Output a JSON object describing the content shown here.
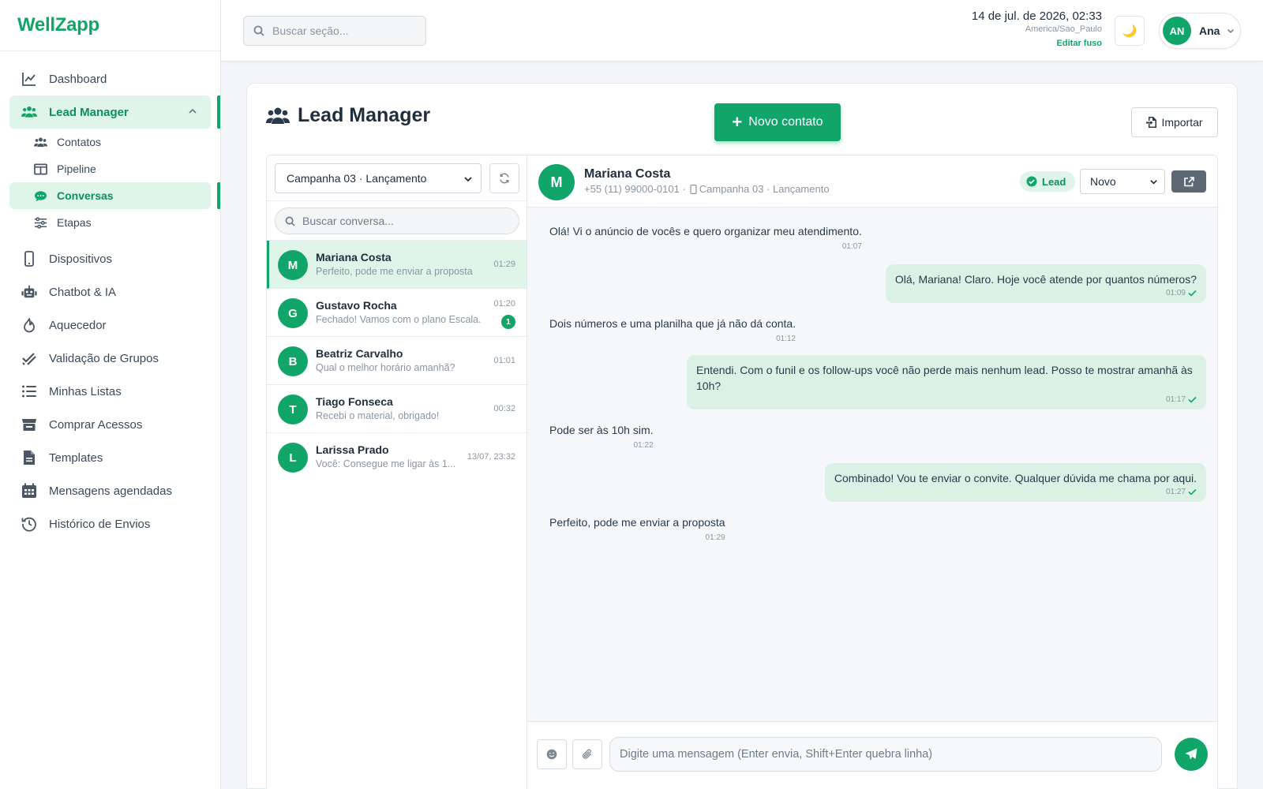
{
  "brand": {
    "name": "WellZapp"
  },
  "topbar": {
    "search_placeholder": "Buscar seção...",
    "datetime": "14 de jul. de 2026, 02:33",
    "timezone": "America/Sao_Paulo",
    "edit_timezone": "Editar fuso",
    "theme_icon": "moon-icon",
    "user": {
      "initials": "AN",
      "name": "Ana"
    }
  },
  "sidebar": {
    "items": [
      {
        "label": "Dashboard",
        "icon": "chart-line-icon"
      },
      {
        "label": "Lead Manager",
        "icon": "users-icon",
        "active": true,
        "expanded": true
      },
      {
        "label": "Dispositivos",
        "icon": "mobile-icon"
      },
      {
        "label": "Chatbot & IA",
        "icon": "robot-icon"
      },
      {
        "label": "Aquecedor",
        "icon": "fire-icon"
      },
      {
        "label": "Validação de Grupos",
        "icon": "check-double-icon"
      },
      {
        "label": "Minhas Listas",
        "icon": "list-icon"
      },
      {
        "label": "Comprar Acessos",
        "icon": "store-icon"
      },
      {
        "label": "Templates",
        "icon": "file-icon"
      },
      {
        "label": "Mensagens agendadas",
        "icon": "calendar-icon"
      },
      {
        "label": "Histórico de Envios",
        "icon": "history-icon"
      }
    ],
    "subitems": [
      {
        "label": "Contatos",
        "icon": "users-icon"
      },
      {
        "label": "Pipeline",
        "icon": "columns-icon"
      },
      {
        "label": "Conversas",
        "icon": "comments-icon",
        "active": true
      },
      {
        "label": "Etapas",
        "icon": "sliders-icon"
      }
    ]
  },
  "page": {
    "title": "Lead Manager",
    "new_contact": "Novo contato",
    "import": "Importar"
  },
  "conversations": {
    "campaign": "Campanha 03 · Lançamento",
    "search_placeholder": "Buscar conversa...",
    "items": [
      {
        "initial": "M",
        "name": "Mariana Costa",
        "preview": "Perfeito, pode me enviar a proposta",
        "time": "01:29",
        "active": true
      },
      {
        "initial": "G",
        "name": "Gustavo Rocha",
        "preview": "Fechado! Vamos com o plano Escala.",
        "time": "01:20",
        "unread": "1"
      },
      {
        "initial": "B",
        "name": "Beatriz Carvalho",
        "preview": "Qual o melhor horário amanhã?",
        "time": "01:01"
      },
      {
        "initial": "T",
        "name": "Tiago Fonseca",
        "preview": "Recebi o material, obrigado!",
        "time": "00:32"
      },
      {
        "initial": "L",
        "name": "Larissa Prado",
        "preview": "Você: Consegue me ligar às 1...",
        "time": "13/07, 23:32"
      }
    ]
  },
  "chat": {
    "contact": {
      "initial": "M",
      "name": "Mariana Costa",
      "phone": "+55 (11) 99000-0101 ·",
      "campaign": "Campanha 03 · Lançamento"
    },
    "tag": "Lead",
    "stage": "Novo",
    "messages": [
      {
        "dir": "in",
        "text": "Olá! Vi o anúncio de vocês e quero organizar meu atendimento.",
        "time": "01:07"
      },
      {
        "dir": "out",
        "text": "Olá, Mariana! Claro. Hoje você atende por quantos números?",
        "time": "01:09"
      },
      {
        "dir": "in",
        "text": "Dois números e uma planilha que já não dá conta.",
        "time": "01:12"
      },
      {
        "dir": "out",
        "text": "Entendi. Com o funil e os follow-ups você não perde mais nenhum lead. Posso te mostrar amanhã às 10h?",
        "time": "01:17"
      },
      {
        "dir": "in",
        "text": "Pode ser às 10h sim.",
        "time": "01:22"
      },
      {
        "dir": "out",
        "text": "Combinado! Vou te enviar o convite. Qualquer dúvida me chama por aqui.",
        "time": "01:27"
      },
      {
        "dir": "in",
        "text": "Perfeito, pode me enviar a proposta",
        "time": "01:29"
      }
    ],
    "composer_placeholder": "Digite uma mensagem (Enter envia, Shift+Enter quebra linha)"
  },
  "colors": {
    "accent": "#12a56a",
    "accent_light": "#e0f5ea",
    "bubble_out": "#dbf1e6"
  }
}
